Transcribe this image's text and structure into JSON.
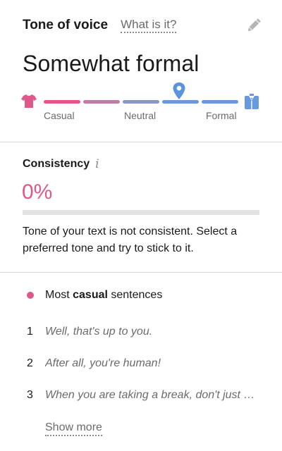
{
  "header": {
    "title": "Tone of voice",
    "what_link": "What is it?"
  },
  "tone": {
    "value": "Somewhat formal",
    "scale_labels": [
      "Casual",
      "Neutral",
      "Formal"
    ],
    "position_fraction": 0.67,
    "colors": {
      "casual": "#e0578a",
      "neutral": "#a57fb5",
      "formal": "#6699dd"
    }
  },
  "consistency": {
    "title": "Consistency",
    "info_icon": "info-icon",
    "value": "0%",
    "fraction": 0.0,
    "description": "Tone of your text is not consistent. Select a preferred tone and try to stick to it."
  },
  "sentences": {
    "legend_prefix": "Most ",
    "legend_bold": "casual",
    "legend_suffix": " sentences",
    "items": [
      {
        "num": "1",
        "text": "Well, that's up to you."
      },
      {
        "num": "2",
        "text": "After all, you're human!"
      },
      {
        "num": "3",
        "text": "When you are taking a break, don't just hang around"
      }
    ],
    "show_more": "Show more"
  }
}
